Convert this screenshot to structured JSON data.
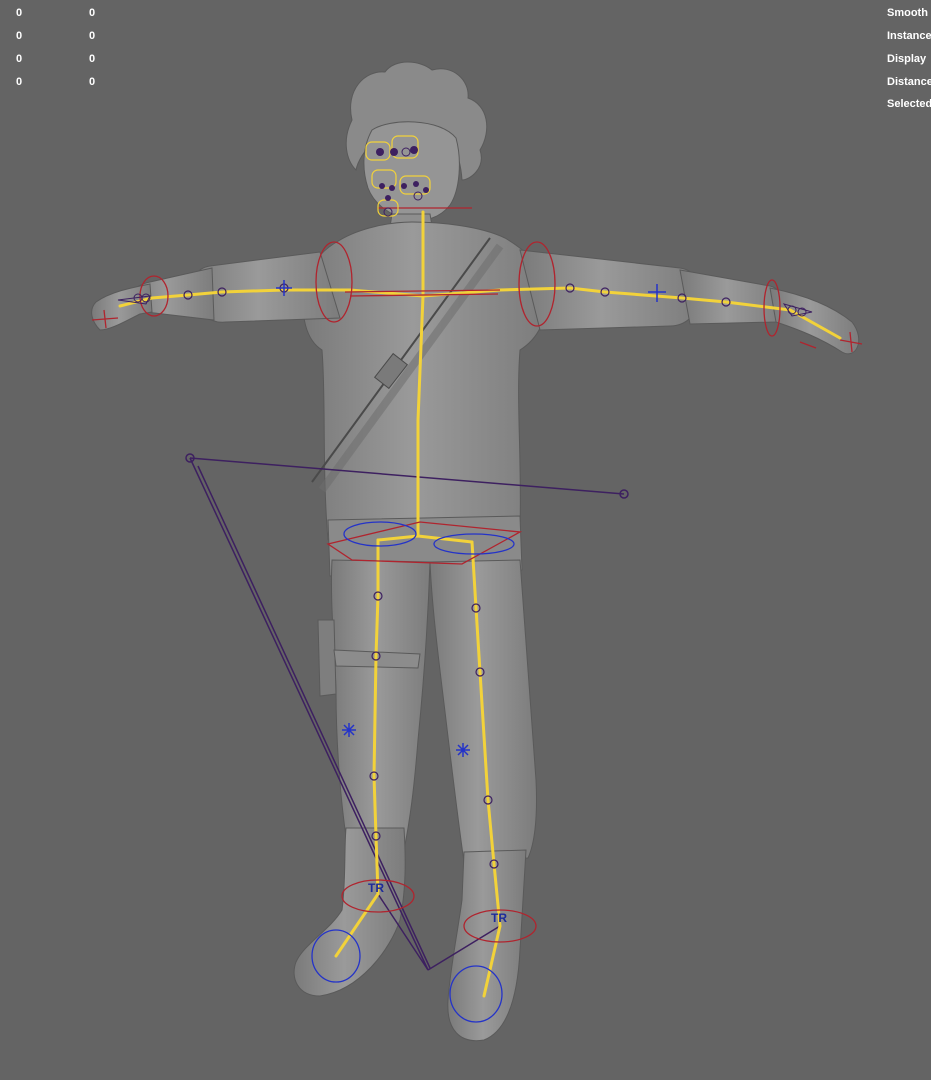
{
  "hud": {
    "left_rows": [
      {
        "a": "0",
        "b": "0"
      },
      {
        "a": "0",
        "b": "0"
      },
      {
        "a": "0",
        "b": "0"
      },
      {
        "a": "0",
        "b": "0"
      }
    ],
    "right_labels": [
      "Smooth",
      "Instance",
      "Display",
      "Distance",
      "Selected"
    ]
  },
  "rig": {
    "foot_label_left": "TR",
    "foot_label_right": "TR"
  },
  "colors": {
    "background": "#646464",
    "mesh": "#8c8c8c",
    "joint": "#f2d23a",
    "control_red": "#b0242e",
    "control_blue": "#2433c8",
    "ik_handle": "#3d2060"
  }
}
